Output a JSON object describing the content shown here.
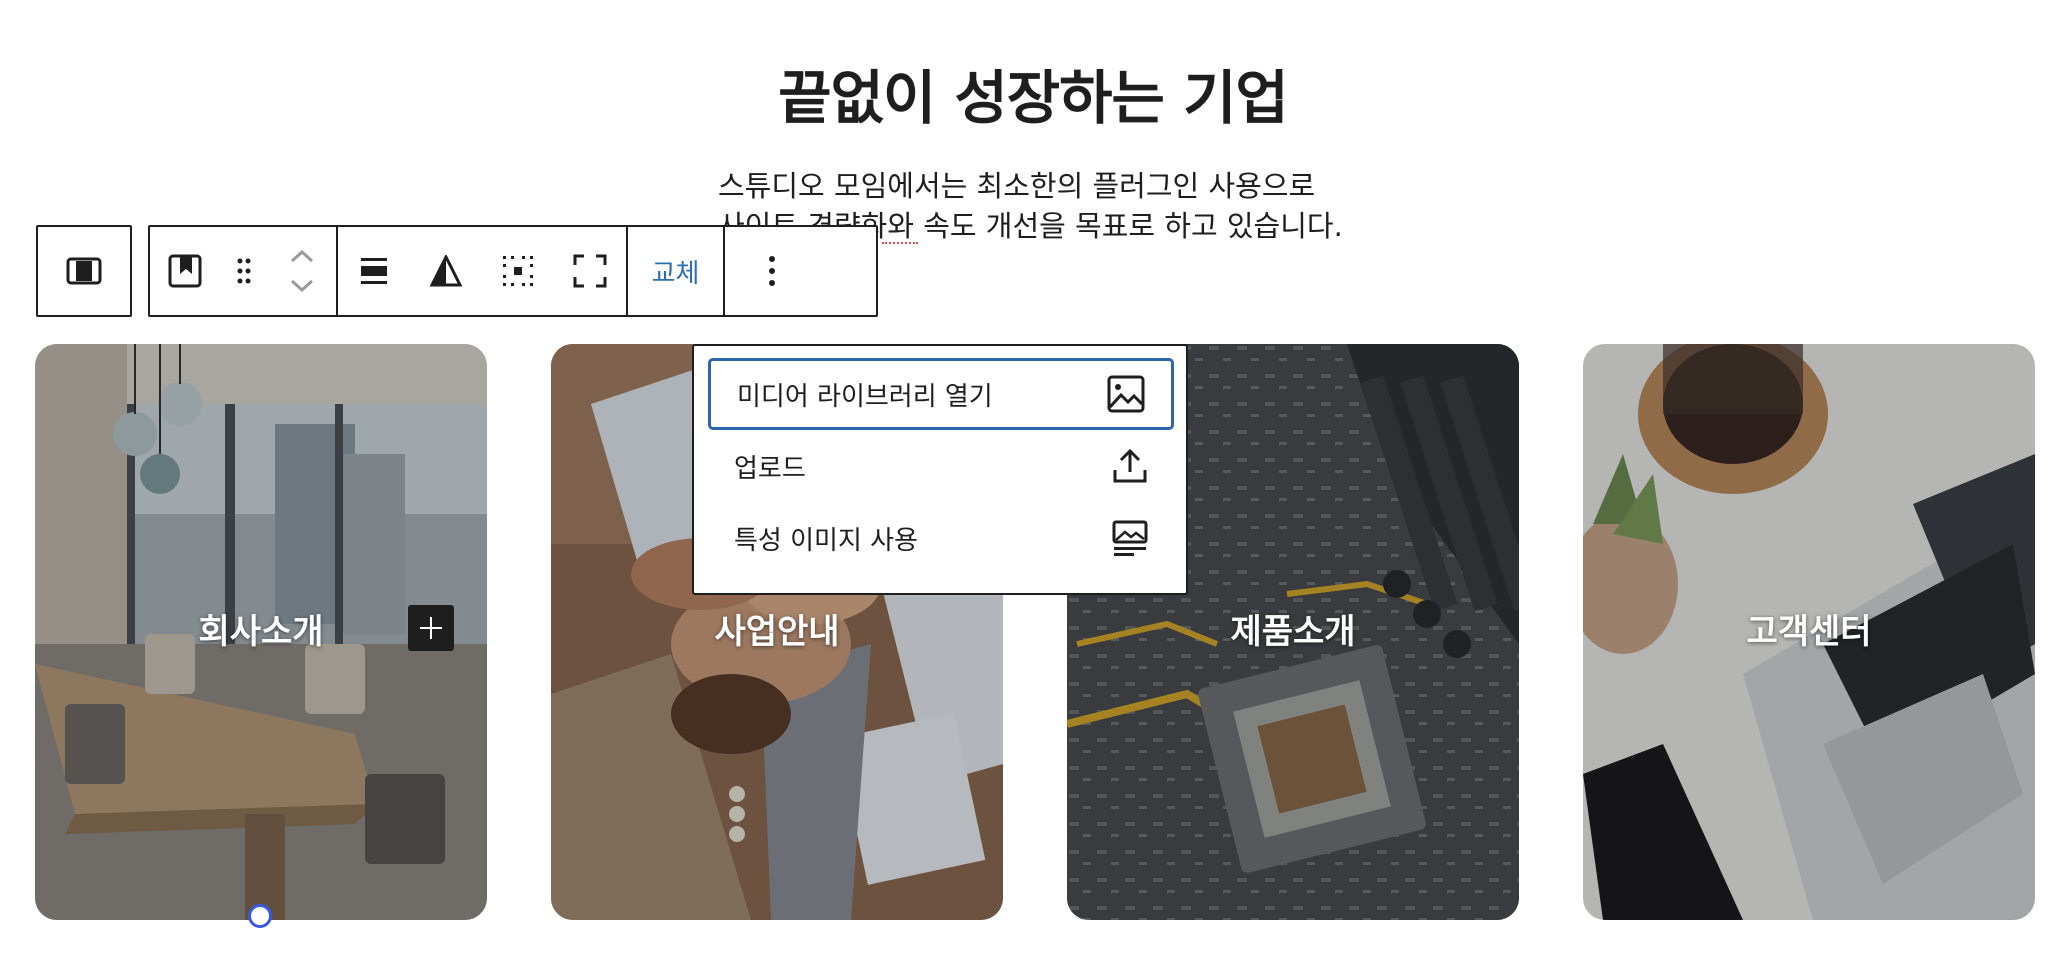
{
  "page": {
    "title": "끝없이 성장하는 기업",
    "intro_line1": "스튜디오 모임에서는 최소한의 플러그인 사용으로",
    "intro_line2": "사이트 경량화와 속도 개선을 목표로 하고 있습니다."
  },
  "toolbar": {
    "parent_icon": "columns-parent-icon",
    "block_icon": "cover-block-icon",
    "drag_icon": "drag-handle-icon",
    "move_icon": "move-up-down-icon",
    "align_icon": "align-wide-icon",
    "overlay_icon": "overlay-contrast-icon",
    "position_icon": "content-position-icon",
    "fullheight_icon": "full-height-icon",
    "replace_label": "교체",
    "more_icon": "more-options-icon"
  },
  "replace_menu": {
    "items": [
      {
        "label": "미디어 라이브러리 열기",
        "icon": "image-icon"
      },
      {
        "label": "업로드",
        "icon": "upload-icon"
      },
      {
        "label": "특성 이미지 사용",
        "icon": "featured-image-icon"
      }
    ]
  },
  "cards": [
    {
      "label": "회사소개",
      "image": "meeting-room-photo"
    },
    {
      "label": "사업안내",
      "image": "team-hands-photo"
    },
    {
      "label": "제품소개",
      "image": "circuit-board-photo"
    },
    {
      "label": "고객센터",
      "image": "laptop-desk-photo"
    }
  ],
  "colors": {
    "accent": "#3858e9",
    "focus_border": "#2b67ad",
    "replace_text": "#2c6fb1"
  }
}
